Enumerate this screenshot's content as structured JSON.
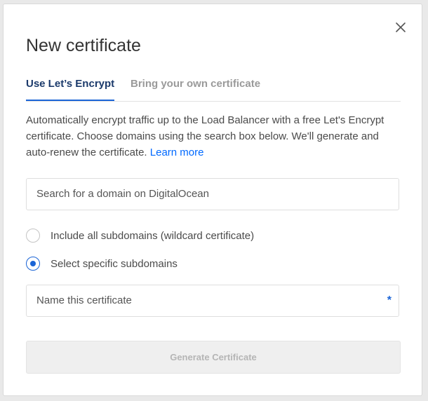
{
  "modal": {
    "title": "New certificate",
    "close_icon": "close-icon"
  },
  "tabs": [
    {
      "label": "Use Let’s Encrypt",
      "active": true
    },
    {
      "label": "Bring your own certificate",
      "active": false
    }
  ],
  "description": {
    "text": "Automatically encrypt traffic up to the Load Balancer with a free Let's Encrypt certificate. Choose domains using the search box below. We'll generate and auto-renew the certificate.",
    "link_label": "Learn more"
  },
  "search": {
    "placeholder": "Search for a domain on DigitalOcean"
  },
  "options": [
    {
      "label": "Include all subdomains (wildcard certificate)",
      "selected": false
    },
    {
      "label": "Select specific subdomains",
      "selected": true
    }
  ],
  "name_field": {
    "placeholder": "Name this certificate",
    "required_marker": "*"
  },
  "generate_button": {
    "label": "Generate Certificate",
    "disabled": true
  },
  "colors": {
    "accent": "#0069ff",
    "tab_active": "#1b3a6b",
    "text": "#4a4a4a"
  }
}
